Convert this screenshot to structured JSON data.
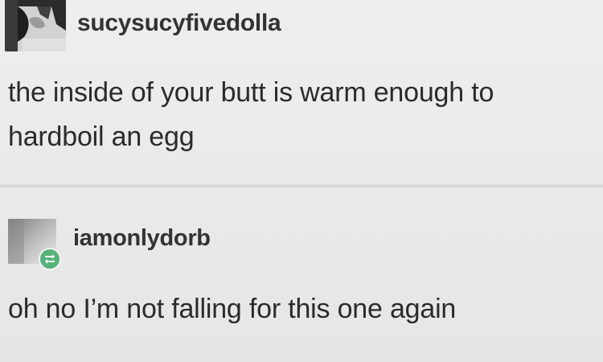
{
  "posts": [
    {
      "username": "sucysucyfivedolla",
      "avatar_icon": "user-avatar-icon",
      "lines": [
        "the inside of your butt is warm enough to",
        "hardboil an egg"
      ]
    },
    {
      "username": "iamonlydorb",
      "avatar_icon": "user-avatar-icon",
      "badge_icon": "reblog-icon",
      "badge_color": "#56b27a",
      "lines": [
        "oh no I’m not falling for this one again"
      ]
    }
  ]
}
